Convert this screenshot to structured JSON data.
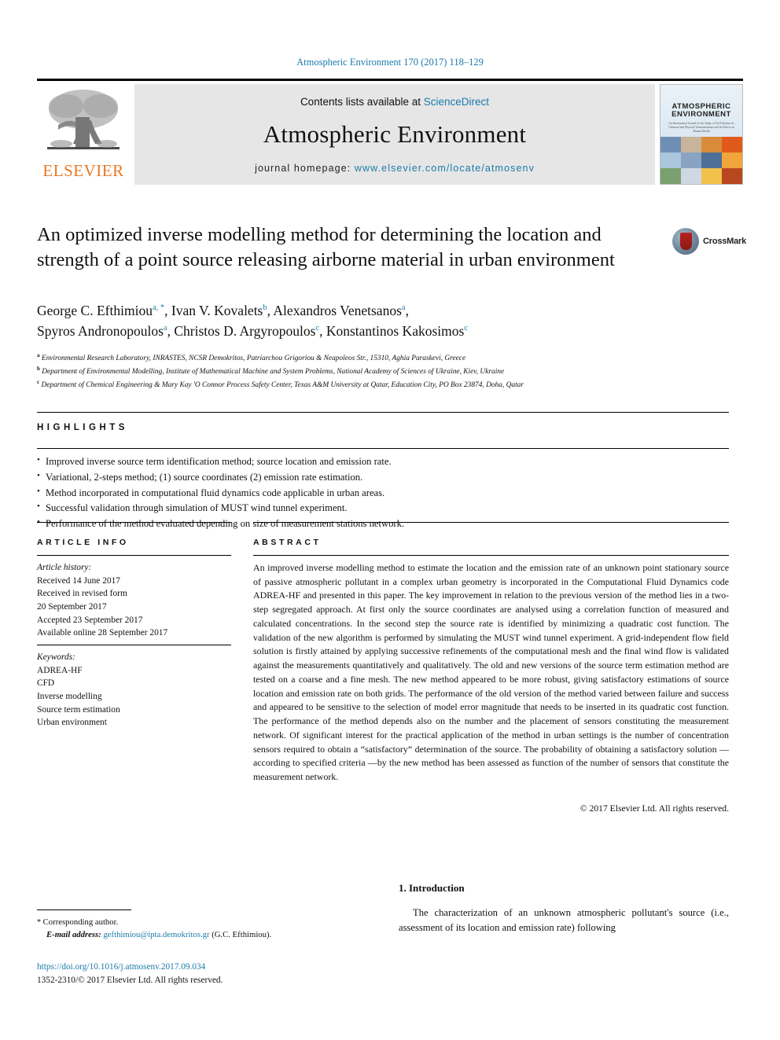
{
  "running_head": "Atmospheric Environment 170 (2017) 118–129",
  "masthead": {
    "publisher_name": "ELSEVIER",
    "contents_prefix": "Contents lists available at ",
    "sciencedirect": "ScienceDirect",
    "journal_title": "Atmospheric Environment",
    "homepage_prefix": "journal homepage: ",
    "homepage_url": "www.elsevier.com/locate/atmosenv",
    "cover": {
      "title_line1": "ATMOSPHERIC",
      "title_line2": "ENVIRONMENT",
      "subtitle": "An International Journal for the Study of Air Pollution, Its Chemical and Physical Transformations and Its Effects on Human Health"
    }
  },
  "article": {
    "title": "An optimized inverse modelling method for determining the location and strength of a point source releasing airborne material in urban environment",
    "crossmark_label": "CrossMark",
    "authors": [
      {
        "name": "George C. Efthimiou",
        "marks": "a, *"
      },
      {
        "name": "Ivan V. Kovalets",
        "marks": "b"
      },
      {
        "name": "Alexandros Venetsanos",
        "marks": "a"
      },
      {
        "name": "Spyros Andronopoulos",
        "marks": "a"
      },
      {
        "name": "Christos D. Argyropoulos",
        "marks": "c"
      },
      {
        "name": "Konstantinos Kakosimos",
        "marks": "c"
      }
    ],
    "affiliations": [
      {
        "mark": "a",
        "text": "Environmental Research Laboratory, INRASTES, NCSR Demokritos, Patriarchou Grigoriou & Neapoleos Str., 15310, Aghia Paraskevi, Greece"
      },
      {
        "mark": "b",
        "text": "Department of Environmental Modelling, Institute of Mathematical Machine and System Problems, National Academy of Sciences of Ukraine, Kiev, Ukraine"
      },
      {
        "mark": "c",
        "text": "Department of Chemical Engineering & Mary Kay 'O Connor Process Safety Center, Texas A&M University at Qatar, Education City, PO Box 23874, Doha, Qatar"
      }
    ]
  },
  "highlights": {
    "heading": "HIGHLIGHTS",
    "items": [
      "Improved inverse source term identification method; source location and emission rate.",
      "Variational, 2-steps method; (1) source coordinates (2) emission rate estimation.",
      "Method incorporated in computational fluid dynamics code applicable in urban areas.",
      "Successful validation through simulation of MUST wind tunnel experiment.",
      "Performance of the method evaluated depending on size of measurement stations network."
    ]
  },
  "article_info": {
    "heading": "ARTICLE INFO",
    "history_label": "Article history:",
    "history": [
      "Received 14 June 2017",
      "Received in revised form",
      "20 September 2017",
      "Accepted 23 September 2017",
      "Available online 28 September 2017"
    ],
    "keywords_label": "Keywords:",
    "keywords": [
      "ADREA-HF",
      "CFD",
      "Inverse modelling",
      "Source term estimation",
      "Urban environment"
    ]
  },
  "abstract": {
    "heading": "ABSTRACT",
    "text": "An improved inverse modelling method to estimate the location and the emission rate of an unknown point stationary source of passive atmospheric pollutant in a complex urban geometry is incorporated in the Computational Fluid Dynamics code ADREA-HF and presented in this paper. The key improvement in relation to the previous version of the method lies in a two-step segregated approach. At first only the source coordinates are analysed using a correlation function of measured and calculated concentrations. In the second step the source rate is identified by minimizing a quadratic cost function. The validation of the new algorithm is performed by simulating the MUST wind tunnel experiment. A grid-independent flow field solution is firstly attained by applying successive refinements of the computational mesh and the final wind flow is validated against the measurements quantitatively and qualitatively. The old and new versions of the source term estimation method are tested on a coarse and a fine mesh. The new method appeared to be more robust, giving satisfactory estimations of source location and emission rate on both grids. The performance of the old version of the method varied between failure and success and appeared to be sensitive to the selection of model error magnitude that needs to be inserted in its quadratic cost function. The performance of the method depends also on the number and the placement of sensors constituting the measurement network. Of significant interest for the practical application of the method in urban settings is the number of concentration sensors required to obtain a “satisfactory” determination of the source. The probability of obtaining a satisfactory solution — according to specified criteria —by the new method has been assessed as function of the number of sensors that constitute the measurement network.",
    "copyright": "© 2017 Elsevier Ltd. All rights reserved."
  },
  "body": {
    "section_heading": "1. Introduction",
    "paragraph": "The characterization of an unknown atmospheric pollutant's source (i.e., assessment of its location and emission rate) following"
  },
  "footnotes": {
    "corresponding_star": "*",
    "corresponding_label": "Corresponding author.",
    "email_label": "E-mail address:",
    "email": "gefthimiou@ipta.demokritos.gr",
    "email_suffix": "(G.C. Efthimiou).",
    "doi": "https://doi.org/10.1016/j.atmosenv.2017.09.034",
    "issn_line": "1352-2310/© 2017 Elsevier Ltd. All rights reserved."
  },
  "colors": {
    "link": "#1a7aab",
    "elsevier_orange": "#e87722",
    "band_gray": "#e6e6e6"
  }
}
